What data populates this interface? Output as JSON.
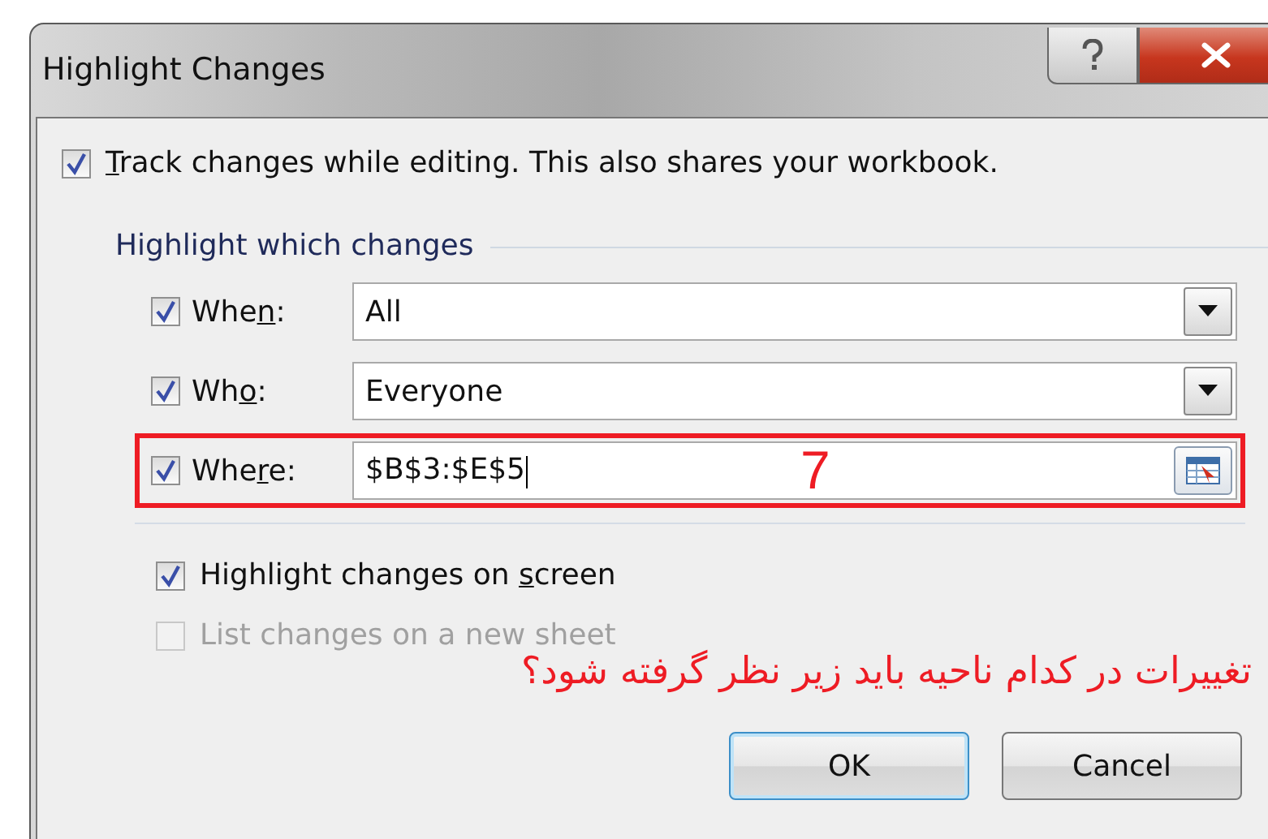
{
  "window": {
    "title": "Highlight Changes"
  },
  "track_changes": {
    "checked": true,
    "label": [
      {
        "t": "T",
        "u": true
      },
      {
        "t": "rack changes while editing. This also shares your workbook."
      }
    ]
  },
  "group_label": "Highlight which changes",
  "filters": [
    {
      "kind": "dropdown",
      "checked": true,
      "label": [
        {
          "t": "Whe"
        },
        {
          "t": "n",
          "u": true
        },
        {
          "t": ":"
        }
      ],
      "value": "All",
      "focused": false,
      "highlighted": false
    },
    {
      "kind": "dropdown",
      "checked": true,
      "label": [
        {
          "t": "Wh"
        },
        {
          "t": "o",
          "u": true
        },
        {
          "t": ":"
        }
      ],
      "value": "Everyone",
      "focused": false,
      "highlighted": false
    },
    {
      "kind": "range",
      "checked": true,
      "label": [
        {
          "t": "Whe"
        },
        {
          "t": "r",
          "u": true
        },
        {
          "t": "e:"
        }
      ],
      "value": "$B$3:$E$5",
      "focused": true,
      "highlighted": true,
      "annotation": "7"
    }
  ],
  "options": [
    {
      "checked": true,
      "disabled": false,
      "label": [
        {
          "t": "Highlight changes on "
        },
        {
          "t": "s",
          "u": true
        },
        {
          "t": "creen"
        }
      ]
    },
    {
      "checked": false,
      "disabled": true,
      "label": [
        {
          "t": "List changes on a new sheet"
        }
      ]
    }
  ],
  "note": "تغییرات در کدام ناحیه باید زیر نظر گرفته شود؟",
  "buttons": [
    {
      "label": "OK",
      "default": true
    },
    {
      "label": "Cancel",
      "default": false
    }
  ]
}
